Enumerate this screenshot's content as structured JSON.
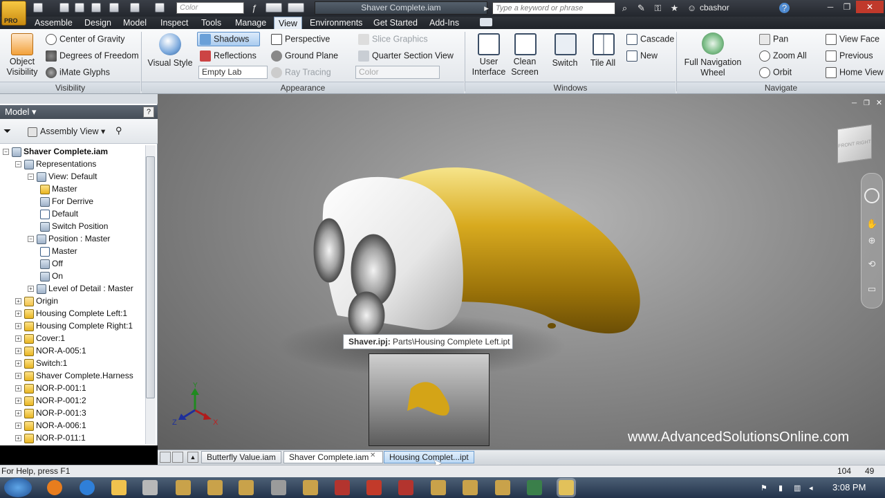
{
  "titlebar": {
    "doc_title": "Shaver Complete.iam",
    "color_placeholder": "Color",
    "search_placeholder": "Type a keyword or phrase",
    "user": "cbashor",
    "logo_text": "PRO"
  },
  "menu": [
    "Assemble",
    "Design",
    "Model",
    "Inspect",
    "Tools",
    "Manage",
    "View",
    "Environments",
    "Get Started",
    "Add-Ins"
  ],
  "menu_active": "View",
  "ribbon": {
    "visibility": {
      "object_visibility": "Object Visibility",
      "center_of_gravity": "Center of Gravity",
      "degrees_of_freedom": "Degrees of Freedom",
      "imate_glyphs": "iMate Glyphs",
      "panel_label": "Visibility"
    },
    "appearance": {
      "visual_style": "Visual Style",
      "shadows": "Shadows",
      "reflections": "Reflections",
      "empty_lab": "Empty Lab",
      "perspective": "Perspective",
      "ground_plane": "Ground Plane",
      "ray_tracing": "Ray Tracing",
      "slice_graphics": "Slice Graphics",
      "quarter_section": "Quarter Section View",
      "color": "Color",
      "panel_label": "Appearance"
    },
    "windows": {
      "user_interface": "User Interface",
      "clean_screen": "Clean Screen",
      "switch": "Switch",
      "tile_all": "Tile All",
      "cascade": "Cascade",
      "new": "New",
      "panel_label": "Windows"
    },
    "navigate": {
      "full_nav_wheel": "Full Navigation Wheel",
      "pan": "Pan",
      "zoom_all": "Zoom All",
      "orbit": "Orbit",
      "view_face": "View Face",
      "previous": "Previous",
      "home_view": "Home View",
      "panel_label": "Navigate"
    }
  },
  "panel": {
    "title": "Model",
    "view_dropdown": "Assembly View",
    "tree": [
      {
        "label": "Shaver Complete.iam",
        "indent": 0
      },
      {
        "label": "Representations",
        "indent": 1
      },
      {
        "label": "View: Default",
        "indent": 2
      },
      {
        "label": "Master",
        "indent": 3
      },
      {
        "label": "For Derrive",
        "indent": 3
      },
      {
        "label": "Default",
        "indent": 3
      },
      {
        "label": "Switch Position",
        "indent": 3
      },
      {
        "label": "Position : Master",
        "indent": 2
      },
      {
        "label": "Master",
        "indent": 3
      },
      {
        "label": "Off",
        "indent": 3
      },
      {
        "label": "On",
        "indent": 3
      },
      {
        "label": "Level of Detail : Master",
        "indent": 2
      },
      {
        "label": "Origin",
        "indent": 1
      },
      {
        "label": "Housing Complete Left:1",
        "indent": 1
      },
      {
        "label": "Housing Complete Right:1",
        "indent": 1
      },
      {
        "label": "Cover:1",
        "indent": 1
      },
      {
        "label": "NOR-A-005:1",
        "indent": 1
      },
      {
        "label": "Switch:1",
        "indent": 1
      },
      {
        "label": "Shaver Complete.Harness",
        "indent": 1
      },
      {
        "label": "NOR-P-001:1",
        "indent": 1
      },
      {
        "label": "NOR-P-001:2",
        "indent": 1
      },
      {
        "label": "NOR-P-001:3",
        "indent": 1
      },
      {
        "label": "NOR-A-006:1",
        "indent": 1
      },
      {
        "label": "NOR-P-011:1",
        "indent": 1
      }
    ]
  },
  "viewport": {
    "tooltip_bold": "Shaver.ipj:",
    "tooltip_path": "Parts\\Housing Complete Left.ipt",
    "watermark": "www.AdvancedSolutionsOnline.com",
    "axis_x": "X",
    "axis_y": "Y",
    "axis_z": "Z",
    "cube_front": "FRONT",
    "cube_right": "RIGHT"
  },
  "tabs": [
    "Butterfly Value.iam",
    "Shaver Complete.iam",
    "Housing Complet...ipt"
  ],
  "status": {
    "help": "For Help, press F1",
    "num1": "104",
    "num2": "49"
  },
  "taskbar": {
    "clock": "3:08 PM"
  },
  "colors": {
    "accent": "#3b78c2",
    "body_gold": "#c89a12",
    "title_bar": "#2b3037"
  }
}
